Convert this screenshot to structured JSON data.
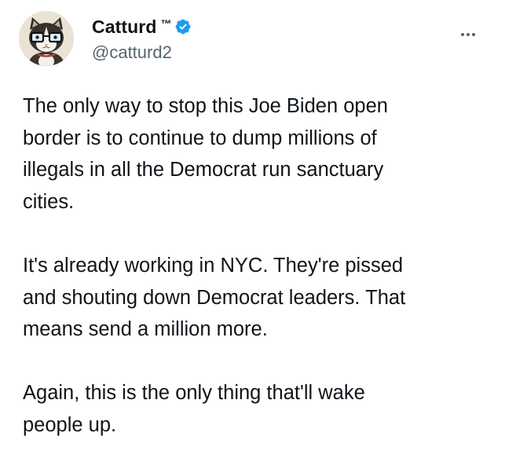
{
  "author": {
    "display_name": "Catturd",
    "tm": "™",
    "handle": "@catturd2",
    "avatar_icon": "cat-with-glasses-avatar",
    "verified_icon": "verified-badge-icon",
    "verified_color": "#1d9bf0"
  },
  "menu": {
    "icon": "more-options-icon"
  },
  "tweet": {
    "paragraphs": [
      {
        "lines": [
          "The only way to stop this Joe Biden open",
          "border is to continue to dump millions of",
          "illegals in all the Democrat run sanctuary",
          "cities."
        ]
      },
      {
        "lines": [
          "It's already working in NYC.  They're pissed",
          "and shouting down Democrat leaders. That",
          "means send a million more."
        ]
      },
      {
        "lines": [
          "Again, this is the only thing that'll wake",
          "people up."
        ]
      }
    ]
  },
  "colors": {
    "text_primary": "#0f1419",
    "text_secondary": "#536471",
    "background": "#ffffff"
  }
}
